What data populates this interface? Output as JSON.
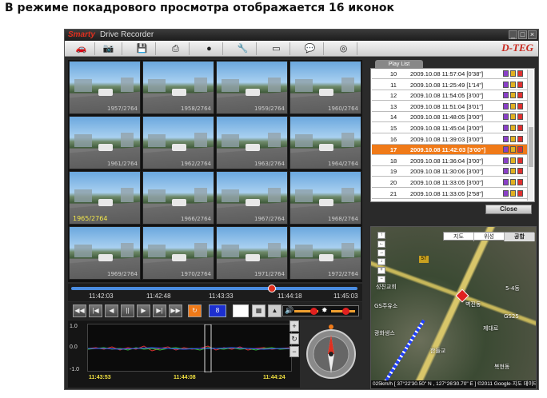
{
  "caption": "В режиме покадрового просмотра отображается 16 иконок",
  "window": {
    "logo": "Smarty",
    "title": "Drive Recorder",
    "brand": "D-TEG",
    "controls": [
      "_",
      "□",
      "×"
    ]
  },
  "toolbar": {
    "icons": [
      "car-icon",
      "camera-icon",
      "save-icon",
      "print-icon",
      "disc-icon",
      "wrench-icon",
      "monitor-icon",
      "chat-icon",
      "cd-icon"
    ]
  },
  "thumbnails": [
    {
      "label": "1957/2764"
    },
    {
      "label": "1958/2764"
    },
    {
      "label": "1959/2764"
    },
    {
      "label": "1960/2764"
    },
    {
      "label": "1961/2764"
    },
    {
      "label": "1962/2764"
    },
    {
      "label": "1963/2764"
    },
    {
      "label": "1964/2764"
    },
    {
      "label": "1965/2764",
      "selected": true
    },
    {
      "label": "1966/2764"
    },
    {
      "label": "1967/2764"
    },
    {
      "label": "1968/2764"
    },
    {
      "label": "1969/2764"
    },
    {
      "label": "1970/2764"
    },
    {
      "label": "1971/2764"
    },
    {
      "label": "1972/2764"
    }
  ],
  "timeline": {
    "times": [
      "11:42:03",
      "11:42:48",
      "11:43:33",
      "11:44:18",
      "11:45:03"
    ],
    "position_fraction": 0.7
  },
  "playback": {
    "buttons": [
      "rewind-fast",
      "skip-start",
      "step-back",
      "pause",
      "play",
      "skip-end",
      "fast-forward",
      "loop"
    ],
    "frame_count": "8"
  },
  "gsensor": {
    "y_labels": [
      "1.0",
      "0.0",
      "-1.0"
    ],
    "x_labels": [
      "11:43:53",
      "11:44:08",
      "11:44:24"
    ],
    "zoom": [
      "+",
      "↻",
      "−"
    ]
  },
  "playlist": {
    "tab": "Play List",
    "rows": [
      {
        "n": "10",
        "t": "2009.10.08 11:57:04 [0'38\"]"
      },
      {
        "n": "11",
        "t": "2009.10.08 11:25:49 [1'14\"]"
      },
      {
        "n": "12",
        "t": "2009.10.08 11:54:05 [3'00\"]"
      },
      {
        "n": "13",
        "t": "2009.10.08 11:51:04 [3'01\"]"
      },
      {
        "n": "14",
        "t": "2009.10.08 11:48:05 [3'00\"]"
      },
      {
        "n": "15",
        "t": "2009.10.08 11:45:04 [3'00\"]"
      },
      {
        "n": "16",
        "t": "2009.10.08 11:39:03 [3'00\"]"
      },
      {
        "n": "17",
        "t": "2009.10.08 11:42:03 [3'00\"]",
        "selected": true
      },
      {
        "n": "18",
        "t": "2009.10.08 11:36:04 [3'00\"]"
      },
      {
        "n": "19",
        "t": "2009.10.08 11:30:06 [3'00\"]"
      },
      {
        "n": "20",
        "t": "2009.10.08 11:33:05 [3'00\"]"
      },
      {
        "n": "21",
        "t": "2009.10.08 11:33:05 [2'58\"]"
      }
    ],
    "close_label": "Close"
  },
  "map": {
    "tabs": [
      "지도",
      "위성",
      "공합"
    ],
    "active_tab": 2,
    "controls": [
      "↑",
      "←",
      "→",
      "↓",
      "+",
      "−"
    ],
    "labels": [
      "성진교회",
      "GS주유소",
      "광화생스",
      "GS25",
      "벽진동",
      "제대로",
      "한들교",
      "5-4동",
      "복현동"
    ],
    "shields": [
      "57"
    ],
    "status": "025km/h  [ 37°22'30.50\" N , 127°26'30.70\" E ]   ©2011 Google·지도 데이터"
  }
}
